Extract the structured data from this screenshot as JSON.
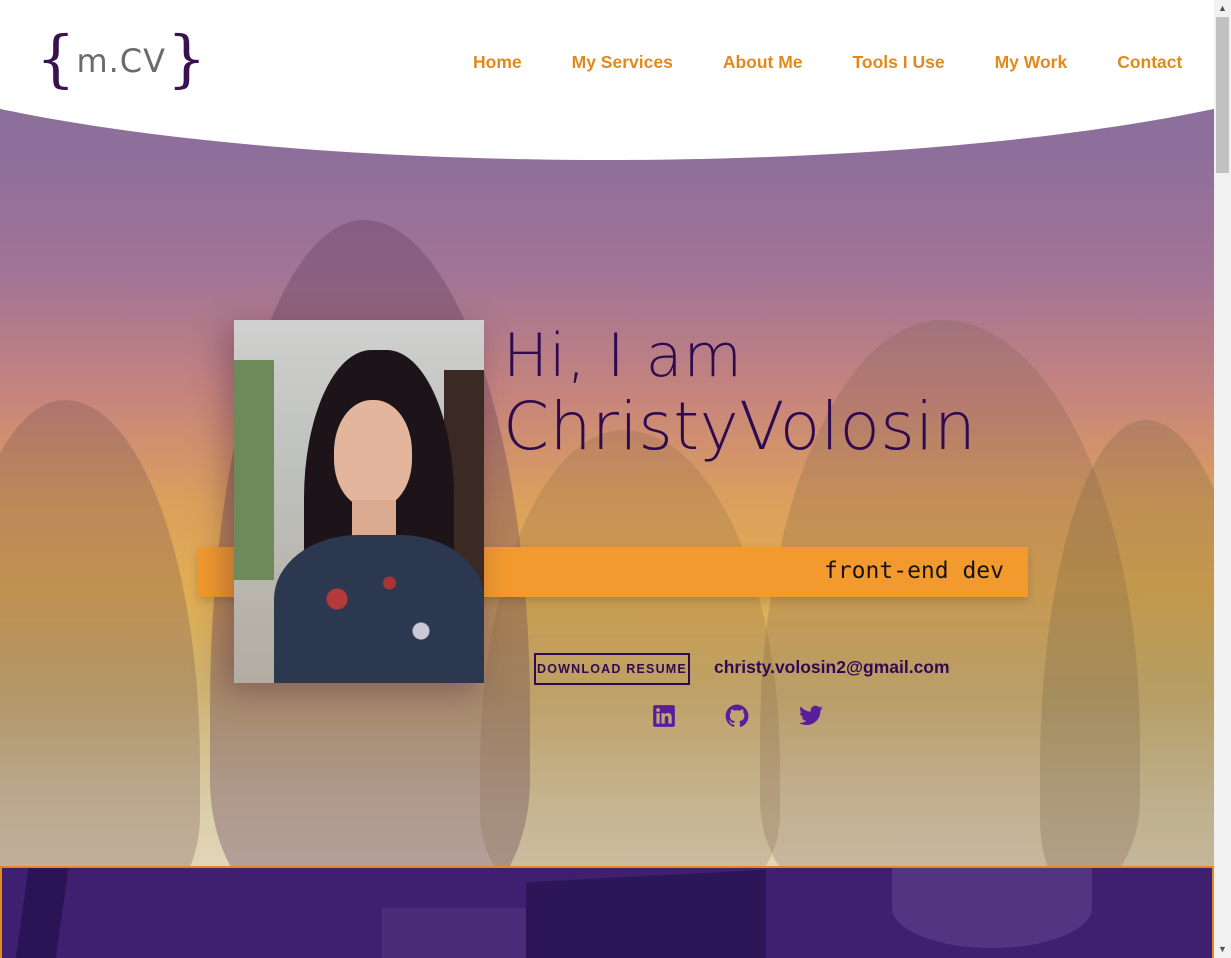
{
  "logo": {
    "open_brace": "{",
    "text": "m.CV",
    "close_brace": "}"
  },
  "nav": [
    {
      "label": "Home"
    },
    {
      "label": "My Services"
    },
    {
      "label": "About Me"
    },
    {
      "label": "Tools I Use"
    },
    {
      "label": "My Work"
    },
    {
      "label": "Contact"
    }
  ],
  "hero": {
    "greeting": "Hi, I am",
    "name": "ChristyVolosin",
    "role": "front-end dev",
    "resume_button": "DOWNLOAD RESUME",
    "email": "christy.volosin2@gmail.com"
  },
  "social": [
    {
      "icon": "linkedin-icon"
    },
    {
      "icon": "github-icon"
    },
    {
      "icon": "twitter-icon"
    }
  ],
  "colors": {
    "accent_orange": "#e08a1e",
    "brand_purple": "#2f0a50",
    "icon_purple": "#5a1e9c",
    "role_bar": "#f29a2e"
  },
  "scrollbar": {
    "up": "▲",
    "down": "▼"
  }
}
